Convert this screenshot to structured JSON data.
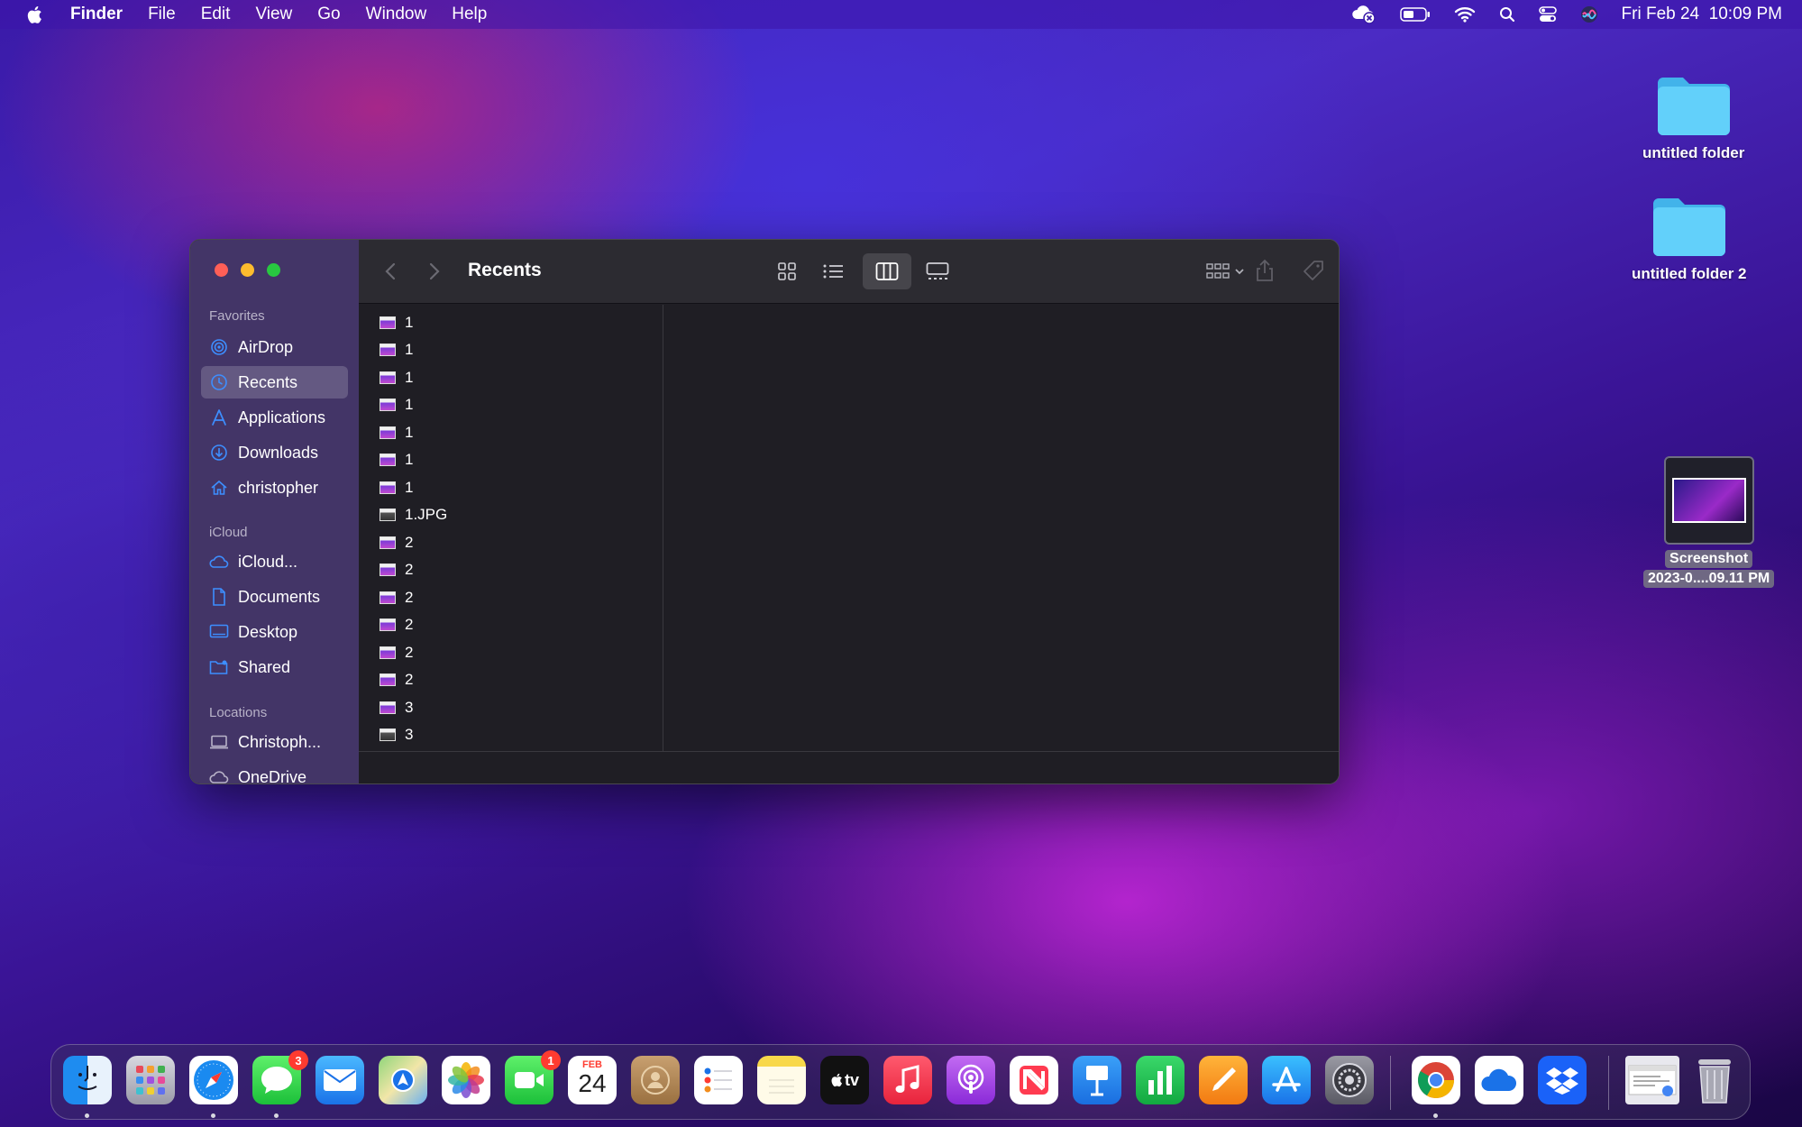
{
  "menubar": {
    "app_name": "Finder",
    "items": [
      "File",
      "Edit",
      "View",
      "Go",
      "Window",
      "Help"
    ],
    "datetime": "Fri Feb 24  10:09 PM"
  },
  "desktop": {
    "folder1": "untitled folder",
    "folder2": "untitled folder 2",
    "screenshot_line1": "Screenshot",
    "screenshot_line2": "2023-0....09.11 PM"
  },
  "finder": {
    "title": "Recents",
    "sidebar": {
      "favorites_heading": "Favorites",
      "favorites": [
        "AirDrop",
        "Recents",
        "Applications",
        "Downloads",
        "christopher"
      ],
      "icloud_heading": "iCloud",
      "icloud": [
        "iCloud...",
        "Documents",
        "Desktop",
        "Shared"
      ],
      "locations_heading": "Locations",
      "locations": [
        "Christoph...",
        "OneDrive"
      ]
    },
    "files": [
      "1",
      "1",
      "1",
      "1",
      "1",
      "1",
      "1",
      "1.JPG",
      "2",
      "2",
      "2",
      "2",
      "2",
      "2",
      "3",
      "3"
    ]
  },
  "dock": {
    "messages_badge": "3",
    "facetime_badge": "1",
    "calendar_month": "FEB",
    "calendar_day": "24",
    "tv_label": "tv"
  },
  "colors": {
    "close": "#ff5f57",
    "minimize": "#febc2e",
    "zoom": "#28c840",
    "accent": "#3d8eff",
    "badge": "#ff3b30"
  }
}
